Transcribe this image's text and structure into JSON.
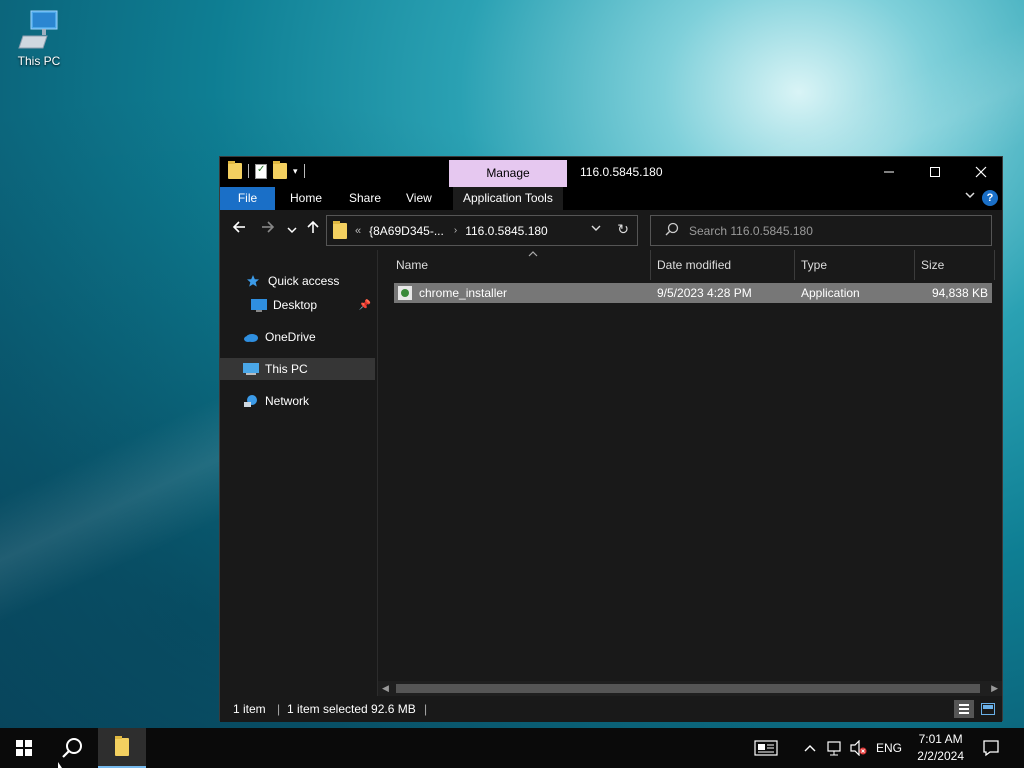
{
  "desktop": {
    "icons": [
      {
        "label": "This PC",
        "icon": "computer-icon"
      }
    ]
  },
  "window": {
    "title": "116.0.5845.180",
    "contextual_tab": "Manage",
    "ribbon_tabs": [
      "File",
      "Home",
      "Share",
      "View",
      "Application Tools"
    ],
    "controls": {
      "minimize": "—",
      "maximize": "☐",
      "close": "✕"
    },
    "help": "?"
  },
  "address": {
    "overflow": "«",
    "parent": "{8A69D345-...",
    "current": "116.0.5845.180"
  },
  "search": {
    "placeholder": "Search 116.0.5845.180"
  },
  "nav_pane": {
    "items": [
      {
        "label": "Quick access",
        "icon": "star-icon"
      },
      {
        "label": "Desktop",
        "icon": "desktop-icon",
        "pinned": true
      },
      {
        "label": "OneDrive",
        "icon": "cloud-icon"
      },
      {
        "label": "This PC",
        "icon": "computer-icon",
        "selected": true
      },
      {
        "label": "Network",
        "icon": "network-icon"
      }
    ]
  },
  "file_list": {
    "columns": [
      "Name",
      "Date modified",
      "Type",
      "Size"
    ],
    "rows": [
      {
        "name": "chrome_installer",
        "date_modified": "9/5/2023 4:28 PM",
        "type": "Application",
        "size": "94,838 KB",
        "selected": true
      }
    ]
  },
  "status": {
    "item_count": "1 item",
    "selection": "1 item selected  92.6 MB"
  },
  "taskbar": {
    "tray": {
      "language": "ENG"
    },
    "clock": {
      "time": "7:01 AM",
      "date": "2/2/2024"
    }
  },
  "colors": {
    "file_tab": "#1a6fc7",
    "manage_tab": "#e6c8f0",
    "window_bg": "#191919",
    "selected_row": "#777777"
  }
}
